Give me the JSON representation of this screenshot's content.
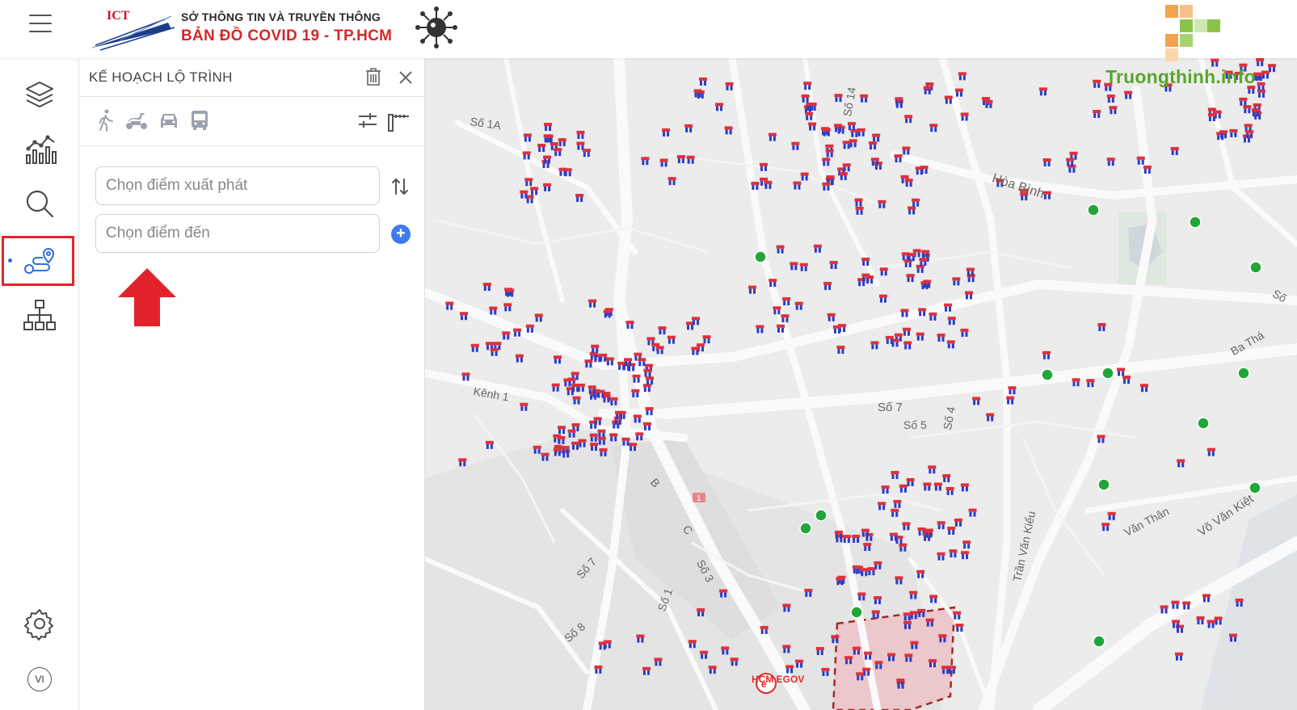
{
  "header": {
    "org_top": "SỞ THÔNG TIN VÀ TRUYỀN THÔNG",
    "org_main": "BẢN ĐỒ  COVID 19 - TP.HCM",
    "ict_logo_text": "ICT",
    "menu_icon": "hamburger-icon",
    "virus_icon": "virus-icon"
  },
  "sidebar": {
    "items": [
      {
        "icon": "layers-icon"
      },
      {
        "icon": "chart-icon"
      },
      {
        "icon": "search-icon"
      },
      {
        "icon": "route-icon",
        "active": true
      },
      {
        "icon": "network-icon"
      }
    ],
    "settings_icon": "gear-icon",
    "language": "VI"
  },
  "route_panel": {
    "title": "KẾ HOẠCH LỘ TRÌNH",
    "modes": [
      "walk-icon",
      "scooter-icon",
      "car-icon",
      "bus-icon"
    ],
    "start_placeholder": "Chọn điểm xuất phát",
    "end_placeholder": "Chọn điểm đến",
    "add_label": "+"
  },
  "map": {
    "road_labels": [
      "Số 1A",
      "Hòa Bình",
      "Kênh 1",
      "Số 7",
      "Số 5",
      "Số 4",
      "Số 14",
      "B",
      "C",
      "Số 7",
      "Số 3",
      "Số 1",
      "Số 8",
      "Trần Văn Kiểu",
      "Văn Thân",
      "Võ Văn Kiệt",
      "Ba Thá",
      "Số"
    ],
    "highway_shield": "1",
    "egov_label": "HCM EGOV",
    "watermark": "Truongthinh.info"
  },
  "colors": {
    "accent_red": "#e3232b",
    "header_red": "#d62828",
    "add_blue": "#3d7bf2",
    "marker_red": "#e0303a",
    "marker_blue": "#2c3ec4",
    "green_marker": "#22a639"
  }
}
